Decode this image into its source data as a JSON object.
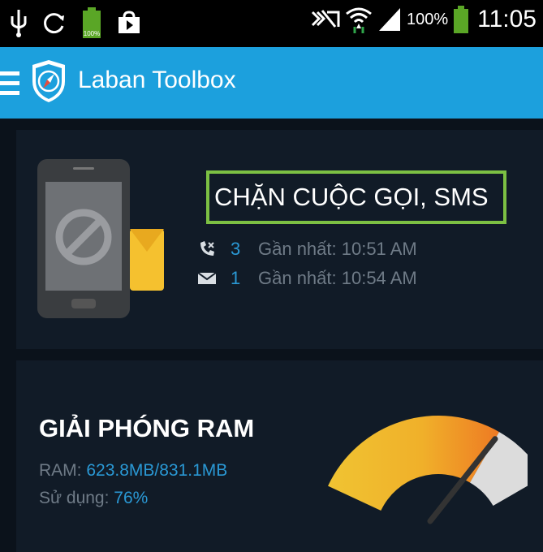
{
  "status_bar": {
    "battery_percent": "100%",
    "time": "11:05",
    "battery_icon_text": "100%"
  },
  "app_bar": {
    "title": "Laban Toolbox"
  },
  "call_block_card": {
    "title": "CHẶN CUỘC GỌI, SMS",
    "call_count": "3",
    "call_latest": "Gần nhất: 10:51 AM",
    "sms_count": "1",
    "sms_latest": "Gần nhất: 10:54 AM"
  },
  "ram_card": {
    "title": "GIẢI PHÓNG RAM",
    "ram_label": "RAM: ",
    "ram_value": "623.8MB/831.1MB",
    "usage_label": "Sử dụng: ",
    "usage_value": "76%",
    "usage_fraction": 0.76
  },
  "colors": {
    "accent": "#1ca0dd",
    "highlight_border": "#7cc043",
    "value_blue": "#2a98d4",
    "card_bg": "#111b27"
  }
}
